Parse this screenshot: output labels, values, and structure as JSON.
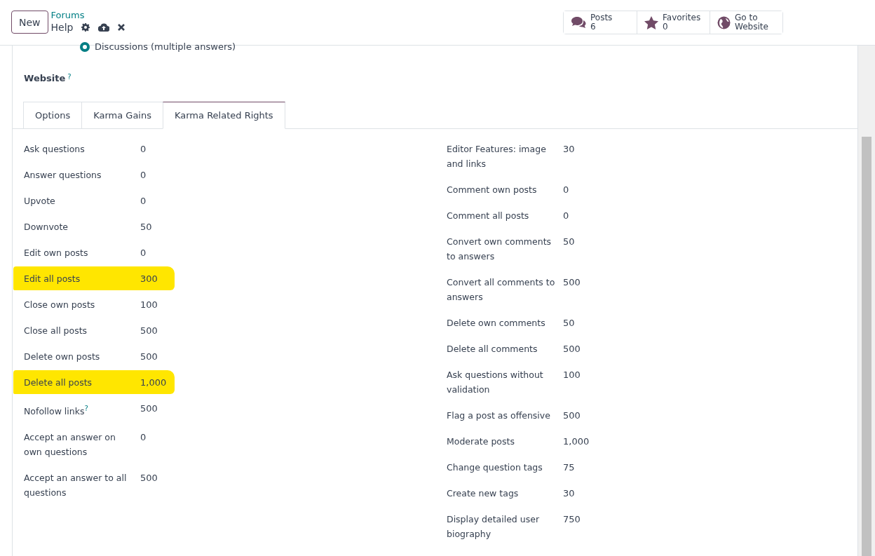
{
  "header": {
    "new_button": "New",
    "breadcrumb": "Forums",
    "title": "Help"
  },
  "stats": [
    {
      "kind": "posts",
      "label": "Posts",
      "value": "6"
    },
    {
      "kind": "favorites",
      "label": "Favorites",
      "value": "0"
    },
    {
      "kind": "website",
      "label": "Go to",
      "value": "Website"
    }
  ],
  "mode_option": {
    "label": "Discussions (multiple answers)",
    "selected": true
  },
  "website_field": {
    "label": "Website",
    "help": "?"
  },
  "tabs": [
    {
      "label": "Options",
      "selected": false
    },
    {
      "label": "Karma Gains",
      "selected": false
    },
    {
      "label": "Karma Related Rights",
      "selected": true
    }
  ],
  "left_fields": [
    {
      "label": "Ask questions",
      "value": "0",
      "highlighted": false
    },
    {
      "label": "Answer questions",
      "value": "0",
      "highlighted": false
    },
    {
      "label": "Upvote",
      "value": "0",
      "highlighted": false
    },
    {
      "label": "Downvote",
      "value": "50",
      "highlighted": false
    },
    {
      "label": "Edit own posts",
      "value": "0",
      "highlighted": false
    },
    {
      "label": "Edit all posts",
      "value": "300",
      "highlighted": true
    },
    {
      "label": "Close own posts",
      "value": "100",
      "highlighted": false
    },
    {
      "label": "Close all posts",
      "value": "500",
      "highlighted": false
    },
    {
      "label": "Delete own posts",
      "value": "500",
      "highlighted": false
    },
    {
      "label": "Delete all posts",
      "value": "1,000",
      "highlighted": true
    },
    {
      "label": "Nofollow links",
      "help": "?",
      "value": "500",
      "highlighted": false
    },
    {
      "label": "Accept an answer on own questions",
      "value": "0",
      "highlighted": false
    },
    {
      "label": "Accept an answer to all questions",
      "value": "500",
      "highlighted": false
    }
  ],
  "right_fields": [
    {
      "label": "Editor Features: image and links",
      "value": "30",
      "highlighted": false
    },
    {
      "label": "Comment own posts",
      "value": "0",
      "highlighted": false
    },
    {
      "label": "Comment all posts",
      "value": "0",
      "highlighted": false
    },
    {
      "label": "Convert own comments to answers",
      "value": "50",
      "highlighted": false
    },
    {
      "label": "Convert all comments to answers",
      "value": "500",
      "highlighted": false
    },
    {
      "label": "Delete own comments",
      "value": "50",
      "highlighted": false
    },
    {
      "label": "Delete all comments",
      "value": "500",
      "highlighted": false
    },
    {
      "label": "Ask questions without validation",
      "value": "100",
      "highlighted": false
    },
    {
      "label": "Flag a post as offensive",
      "value": "500",
      "highlighted": false
    },
    {
      "label": "Moderate posts",
      "value": "1,000",
      "highlighted": false
    },
    {
      "label": "Change question tags",
      "value": "75",
      "highlighted": false
    },
    {
      "label": "Create new tags",
      "value": "30",
      "highlighted": false
    },
    {
      "label": "Display detailed user biography",
      "value": "750",
      "highlighted": false
    }
  ]
}
